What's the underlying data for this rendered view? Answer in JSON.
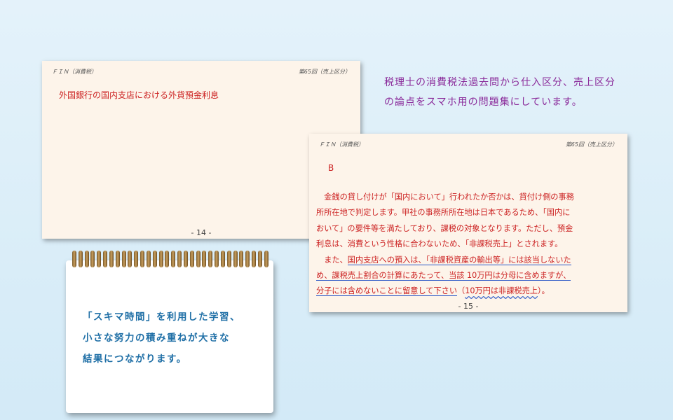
{
  "card1": {
    "header_left": "ＦＩＮ（消費税）",
    "header_right": "第65回（売上区分）",
    "question": "外国銀行の国内支店における外貨預金利息",
    "page_num": "- 14 -"
  },
  "card2": {
    "header_left": "ＦＩＮ（消費税）",
    "header_right": "第65回（売上区分）",
    "answer": "B",
    "line1": "　金銭の貸し付けが「国内において」行われたか否かは、貸付け側の事務",
    "line2": "所所在地で判定します。甲社の事務所所在地は日本であるため、「国内に",
    "line3": "おいて」の要件等を満たしており、課税の対象となります。ただし、預金",
    "line4": "利息は、消費という性格に合わないため、「非課税売上」とされます。",
    "line5_pre": "　また、",
    "line5_ul": "国内支店への預入は、「非課税資産の輸出等」には該当しないた",
    "line6": "め、課税売上割合の計算にあたって、当該 10万円は分母に含めますが、",
    "line7_ul": "分子には含めないことに留意して下さい",
    "line7_paren_open": "（",
    "line7_wavy": "10万円は非課税売上",
    "line7_paren_close": "）。",
    "page_num": "- 15 -"
  },
  "intro": {
    "line1": "税理士の消費税法過去問から仕入区分、売上区分",
    "line2": "の論点をスマホ用の問題集にしています。"
  },
  "notebook": {
    "line1": "「スキマ時間」を利用した学習、",
    "line2": "小さな努力の積み重ねが大きな",
    "line3": "結果につながります。"
  }
}
